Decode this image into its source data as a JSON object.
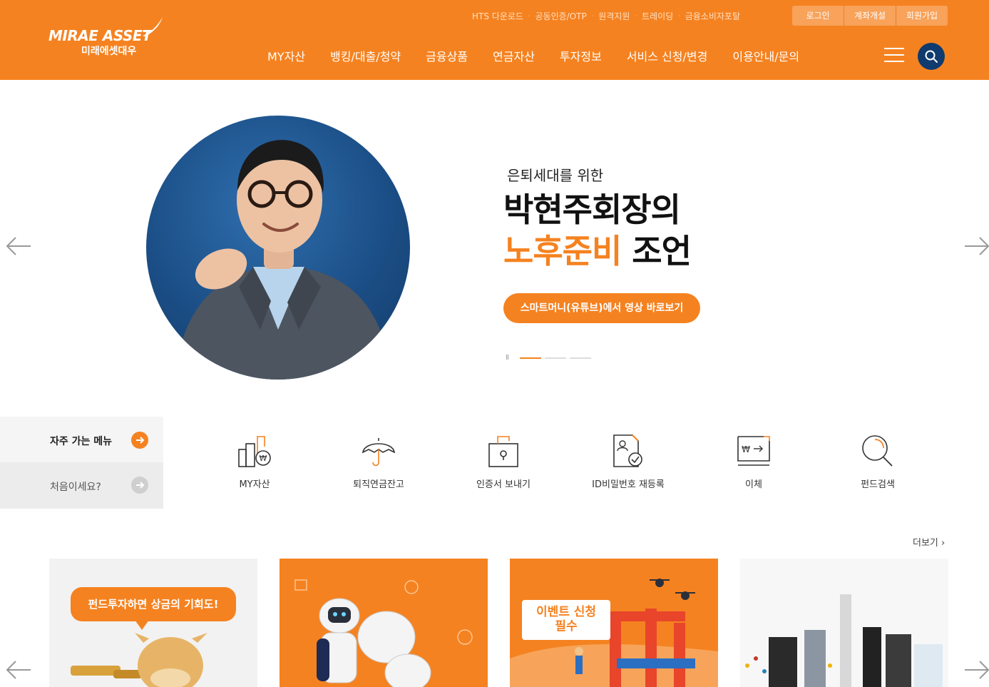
{
  "header": {
    "logo_en": "MIRAE ASSET",
    "logo_ko": "미래에셋대우",
    "util_links": [
      "HTS 다운로드",
      "공동인증/OTP",
      "원격지원",
      "트레이딩",
      "금융소비자포탈"
    ],
    "account_buttons": [
      "로그인",
      "계좌개설",
      "회원가입"
    ],
    "gnb": [
      "MY자산",
      "뱅킹/대출/청약",
      "금융상품",
      "연금자산",
      "투자정보",
      "서비스 신청/변경",
      "이용안내/문의"
    ]
  },
  "hero": {
    "subtitle": "은퇴세대를 위한",
    "title_line1": "박현주회장의",
    "title_line2_highlight": "노후준비",
    "title_line2_rest": "조언",
    "cta": "스마트머니(유튜브)에서 영상 바로보기",
    "pause_symbol": "II",
    "slides_total": 3,
    "slide_current": 1
  },
  "quick": {
    "tab_frequent": "자주 가는 메뉴",
    "tab_first": "처음이세요?",
    "items": [
      {
        "label": "MY자산",
        "icon": "my-assets-icon"
      },
      {
        "label": "퇴직연금잔고",
        "icon": "umbrella-icon"
      },
      {
        "label": "인증서 보내기",
        "icon": "certificate-send-icon"
      },
      {
        "label": "ID비밀번호 재등록",
        "icon": "id-password-icon"
      },
      {
        "label": "이체",
        "icon": "transfer-icon"
      },
      {
        "label": "펀드검색",
        "icon": "fund-search-icon"
      }
    ]
  },
  "cards": {
    "more": "더보기",
    "card1_text": "펀드투자하면 상금의 기회도!",
    "card3_text_line1": "이벤트 신청",
    "card3_text_line2": "필수"
  },
  "colors": {
    "brand": "#f58220",
    "search": "#0f3b6e"
  }
}
